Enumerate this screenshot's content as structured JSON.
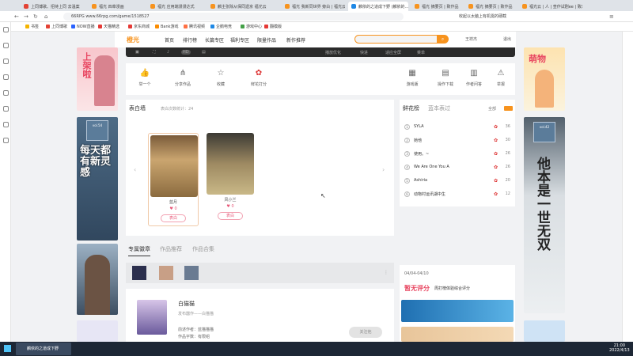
{
  "browser": {
    "tabs": [
      {
        "label": "上同博歌、招待上同 去温案",
        "color": "#e34234"
      },
      {
        "label": "福光 四章漫画",
        "color": "#f7931e"
      },
      {
        "label": "福光 应用端漫漫达式",
        "color": "#f7931e"
      },
      {
        "label": "麟主张除从保同遗京 福光云",
        "color": "#f7931e"
      },
      {
        "label": "福光 我新同世界 旁白 | 福光云",
        "color": "#f7931e"
      },
      {
        "label": "麟依的之道成下野 (麟依的...",
        "color": "#1e88e5",
        "active": true
      },
      {
        "label": "福光 摘要页 | 致作品",
        "color": "#f7931e"
      },
      {
        "label": "福光 摘要页 | 致作品",
        "color": "#f7931e"
      },
      {
        "label": "福光云 | 人 | 查作试剧ee | 致乐",
        "color": "#f7931e"
      }
    ],
    "url": "66RPG www.66rpg.com/game/1518527",
    "search_text": "收起以太脑上有机需的硬截",
    "bookmarks": [
      {
        "label": "书签",
        "color": "#f5b400"
      },
      {
        "label": "上同博歌",
        "color": "#e34234"
      },
      {
        "label": "NOW直播",
        "color": "#2962ff"
      },
      {
        "label": "天猫精选",
        "color": "#e53935"
      },
      {
        "label": "京东商城",
        "color": "#e53935"
      },
      {
        "label": "Bank游戏",
        "color": "#fb8c00"
      },
      {
        "label": "腾讯视频",
        "color": "#ff7043"
      },
      {
        "label": "企鹅电竞",
        "color": "#1e88e5"
      },
      {
        "label": "游戏中心",
        "color": "#43a047"
      },
      {
        "label": "翻模版",
        "color": "#e53935"
      }
    ]
  },
  "site": {
    "logo": "橙光",
    "nav": [
      "首页",
      "排行榜",
      "长篇专区",
      "福利专区",
      "限量作品",
      "新作推荐"
    ],
    "search_icon": "search-icon",
    "user": [
      "王祥杰",
      "退出"
    ]
  },
  "player": {
    "controls": [
      "播放优化",
      "快进",
      "适应全屏",
      "菜单"
    ]
  },
  "actions": [
    {
      "icon": "thumb-up-icon",
      "label": "举一个"
    },
    {
      "icon": "share-icon",
      "label": "分享作品"
    },
    {
      "icon": "star-icon",
      "label": "收藏"
    },
    {
      "icon": "flower-icon",
      "label": "鲜花打分"
    },
    {
      "icon": "grid-icon",
      "label": "游戏版"
    },
    {
      "icon": "doc-icon",
      "label": "操作下载"
    },
    {
      "icon": "calendar-icon",
      "label": "作者问答"
    },
    {
      "icon": "warning-icon",
      "label": "举报"
    }
  ],
  "confession": {
    "title": "表白墙",
    "count_text": "表白次数统计：24",
    "cards": [
      {
        "name": "蓝月",
        "likes": "0",
        "button": "表白"
      },
      {
        "name": "风小兰",
        "likes": "0",
        "button": "表白"
      }
    ]
  },
  "rank": {
    "tabs": [
      "鲜花榜",
      "蓝本表过"
    ],
    "right": [
      "全部"
    ],
    "rows": [
      {
        "no": "1",
        "name": "SYLA",
        "count": "36"
      },
      {
        "no": "2",
        "name": "她他",
        "count": "30"
      },
      {
        "no": "3",
        "name": "使用。~",
        "count": "26"
      },
      {
        "no": "4",
        "name": "We Are One You A",
        "count": "26"
      },
      {
        "no": "5",
        "name": "Ashiria",
        "count": "20"
      },
      {
        "no": "6",
        "name": "动物村运讯湖中生",
        "count": "12"
      }
    ]
  },
  "lower_tabs": [
    "专属徽章",
    "作品推荐",
    "作品合集"
  ],
  "profile": {
    "name": "白猫猫",
    "subtitle": "发布器作——白猫猫",
    "lines": [
      "前述作者：蓝猫猫猫",
      "作品字数：有限组"
    ],
    "button": "关注他"
  },
  "ads": {
    "left_top": "上架啦",
    "left_mid": "每天都有新灵感",
    "right_top": "萌物",
    "right_mid": "他本是一世无双"
  },
  "sidebar_promo": {
    "date": "04/04-04/10",
    "title": "暂无评分",
    "sub": "周打榜体验综合评分"
  },
  "taskbar": {
    "app": "麟依的之道成下野",
    "time": "21:00",
    "date": "2022/4/13"
  }
}
